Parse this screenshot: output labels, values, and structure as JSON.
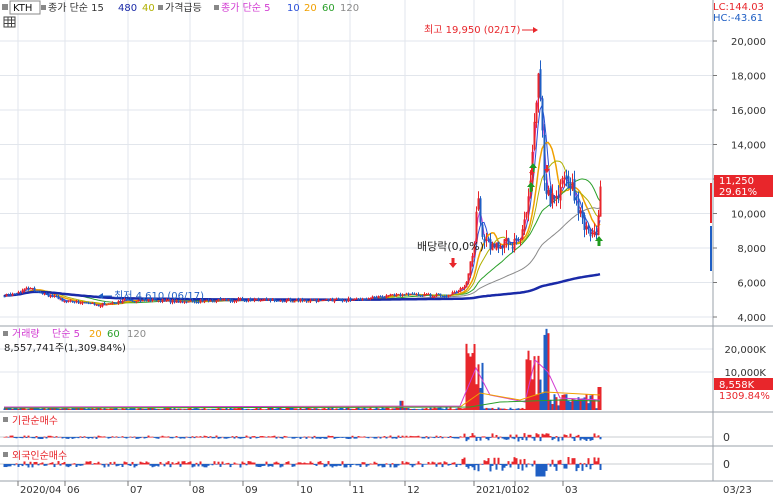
{
  "legend_main": {
    "ticker": "KTH",
    "price_ma_label": "종가 단순 15",
    "vol480": "480",
    "vol40": "40",
    "surge_label": "가격급등",
    "ma_label": "종가 단순 5",
    "ma10": "10",
    "ma20": "20",
    "ma60": "60",
    "ma120": "120"
  },
  "legend_volume": {
    "label": "거래량",
    "type": "단순 5",
    "p20": "20",
    "p60": "60",
    "p120": "120",
    "summary": "8,557,741주(1,309.84%)"
  },
  "legend_inst": "기관순매수",
  "legend_foreign": "외국인순매수",
  "corner": {
    "lc": "LC:144.03",
    "hc": "HC:-43.61"
  },
  "annotations": {
    "high": "최고 19,950 (02/17)",
    "low": "최저 4,610 (06/17)",
    "ex_div": "배당락(0,0%)"
  },
  "badges": {
    "price": "11,250",
    "pct": "29.61%",
    "volume": "8,558K",
    "volume_pct": "1309.84%"
  },
  "axes": {
    "price_ticks": [
      "20,000",
      "18,000",
      "16,000",
      "14,000",
      "12,000",
      "10,000",
      "8,000",
      "6,000",
      "4,000"
    ],
    "volume_ticks": [
      "20,000K",
      "10,000K"
    ],
    "inst_tick": "0",
    "foreign_tick": "0",
    "date_labels": [
      "2020/04",
      "06",
      "07",
      "08",
      "09",
      "10",
      "11",
      "12",
      "2021/01",
      "02",
      "03"
    ],
    "right_date": "03/23"
  },
  "colors": {
    "up": "#e8262b",
    "down": "#1f5fc4",
    "ma5": "#d23cd2",
    "ma10": "#2a4fd8",
    "ma20": "#f0a000",
    "ma60": "#2aa02a",
    "ma120": "#8a8a8a",
    "ma480": "#1a2aa8",
    "ma15": "#b0b000"
  },
  "chart_data": {
    "type": "candlestick",
    "title": "KTH",
    "ylim": [
      3500,
      20400
    ],
    "high": 19950,
    "low": 4610,
    "last_close": 11250,
    "change_pct": 29.61,
    "key_points": [
      {
        "x": "2020/04",
        "y": 5200
      },
      {
        "x": "2020/06",
        "y": 4700
      },
      {
        "x": "2020/07",
        "y": 5000
      },
      {
        "x": "2020/09",
        "y": 5000
      },
      {
        "x": "2020/11",
        "y": 5000
      },
      {
        "x": "2020/12",
        "y": 5200
      },
      {
        "x": "2021/01",
        "y": 8200
      },
      {
        "x": "2021/02",
        "y": 17600
      },
      {
        "x": "2021/03",
        "y": 11000
      },
      {
        "x": "03/23",
        "y": 11250
      }
    ],
    "volume_last": 8557741,
    "volume_pct": 1309.84
  }
}
